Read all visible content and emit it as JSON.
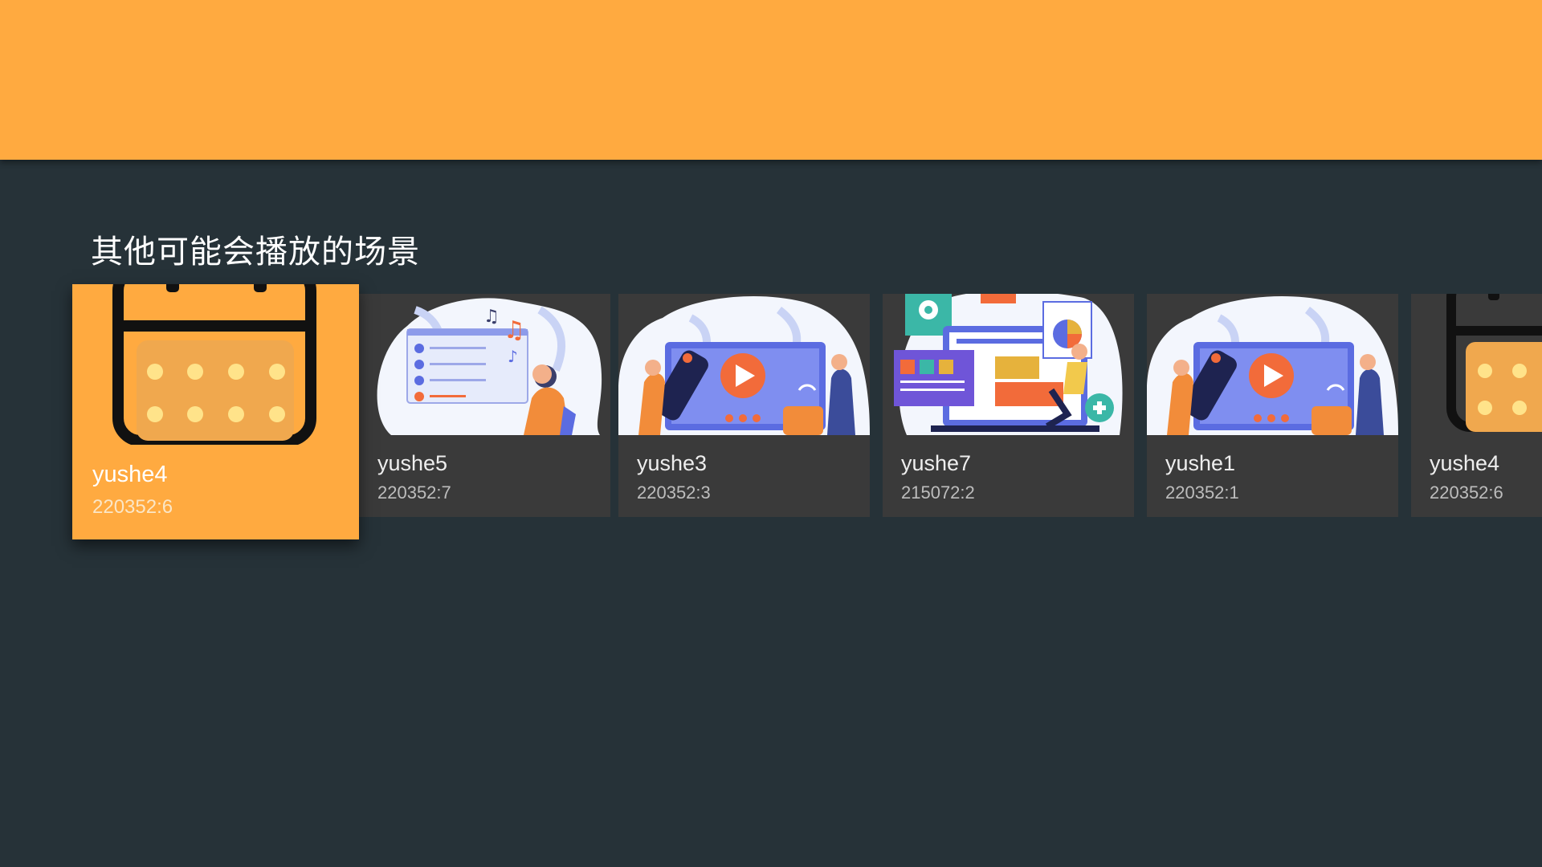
{
  "row": {
    "title": "其他可能会播放的场景",
    "cards": [
      {
        "title": "yushe4",
        "subtitle": "220352:6",
        "icon": "calendar-icon"
      },
      {
        "title": "yushe5",
        "subtitle": "220352:7",
        "icon": "music-player-illustration"
      },
      {
        "title": "yushe3",
        "subtitle": "220352:3",
        "icon": "tv-remote-illustration"
      },
      {
        "title": "yushe7",
        "subtitle": "215072:2",
        "icon": "dashboard-illustration"
      },
      {
        "title": "yushe1",
        "subtitle": "220352:1",
        "icon": "tv-remote-illustration"
      },
      {
        "title": "yushe4",
        "subtitle": "220352:6",
        "icon": "calendar-icon"
      }
    ]
  },
  "colors": {
    "header": "#FFAA40",
    "background": "#263238",
    "card": "#3a3a3a",
    "accent_orange": "#F26B3A",
    "accent_blue": "#5B6CE1"
  }
}
